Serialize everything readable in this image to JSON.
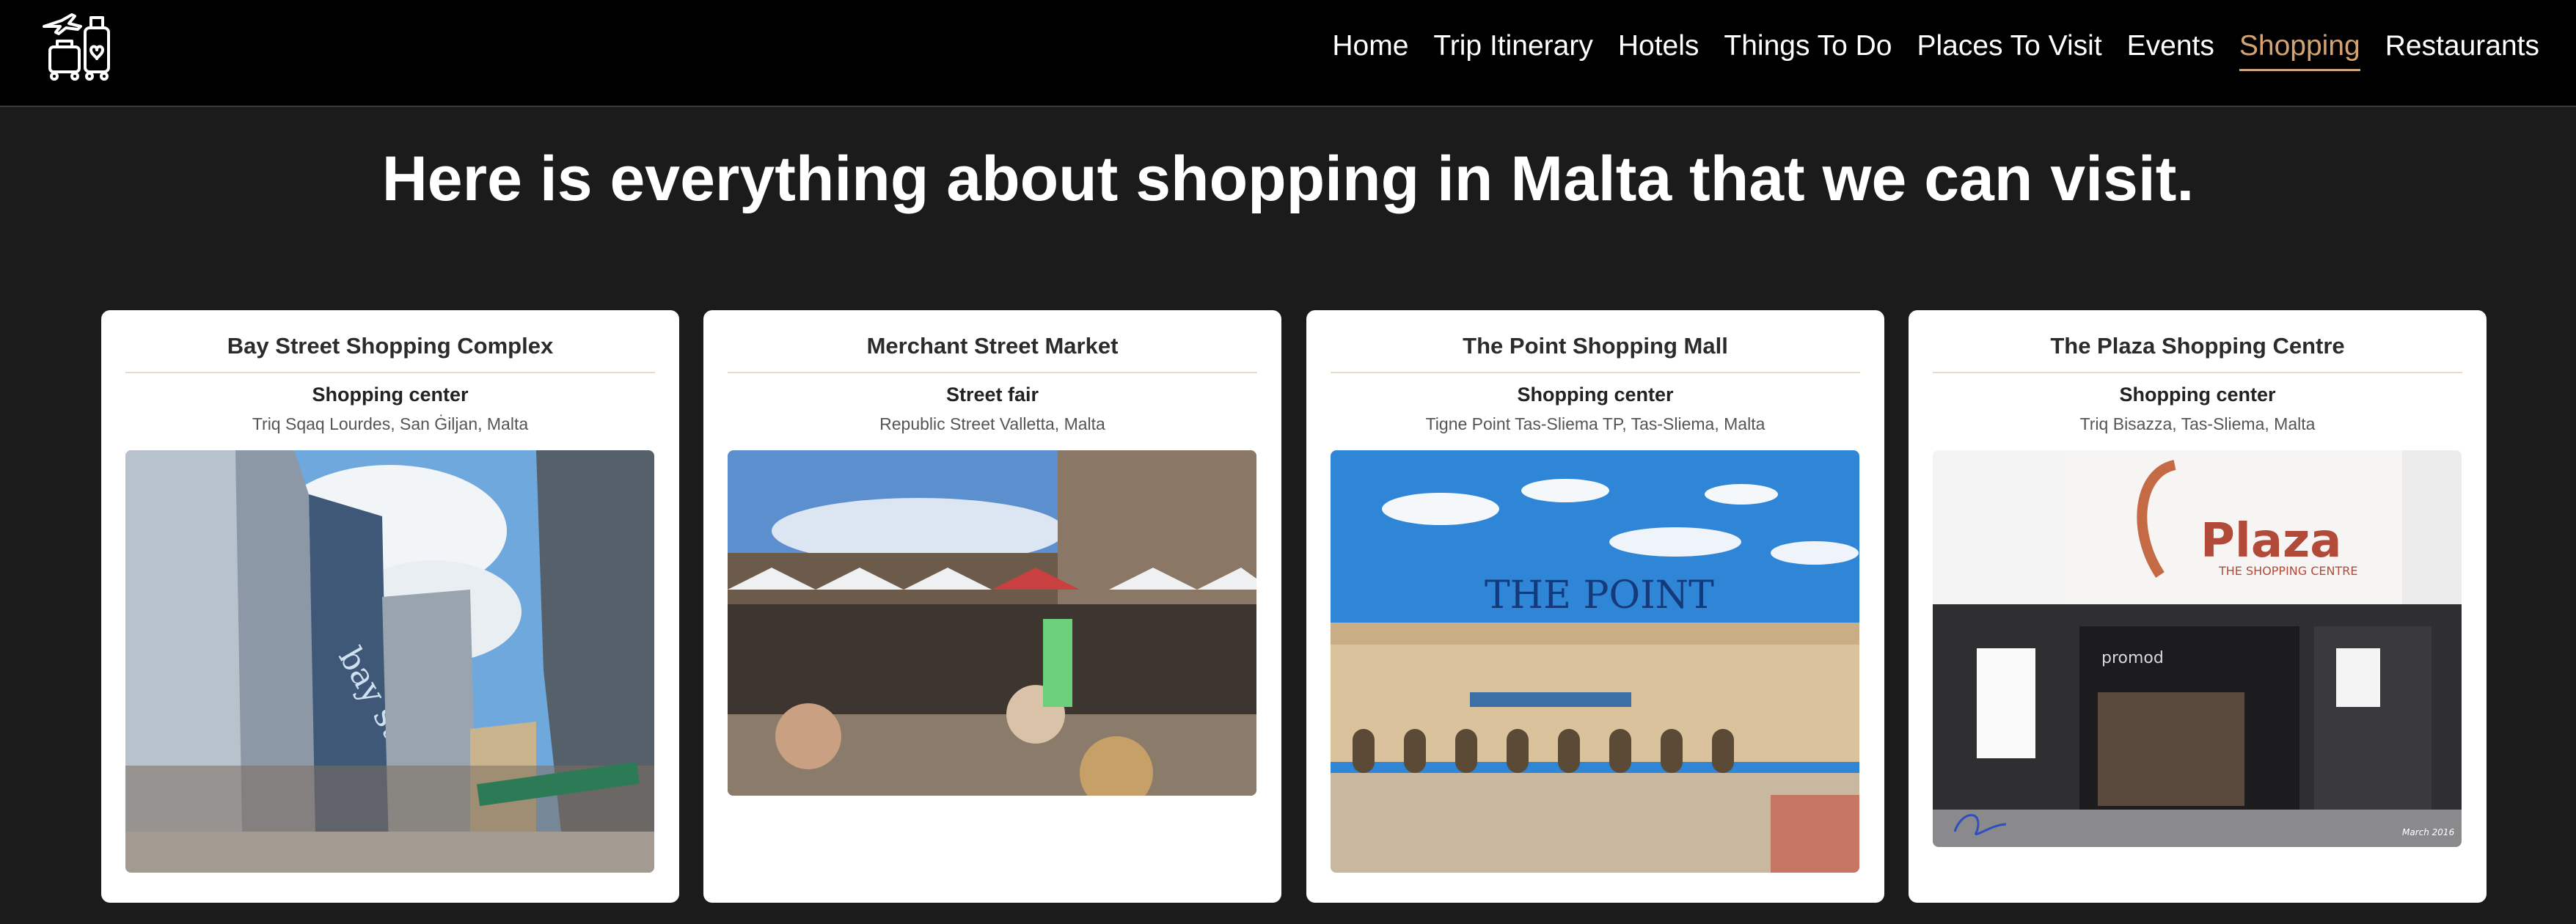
{
  "nav": {
    "logo_icon": "travel-luggage-logo-icon",
    "links": [
      {
        "label": "Home",
        "active": false
      },
      {
        "label": "Trip Itinerary",
        "active": false
      },
      {
        "label": "Hotels",
        "active": false
      },
      {
        "label": "Things To Do",
        "active": false
      },
      {
        "label": "Places To Visit",
        "active": false
      },
      {
        "label": "Events",
        "active": false
      },
      {
        "label": "Shopping",
        "active": true
      },
      {
        "label": "Restaurants",
        "active": false
      }
    ],
    "active_color": "#d4a373"
  },
  "page": {
    "title": "Here is everything about shopping in Malta that we can visit."
  },
  "cards": [
    {
      "title": "Bay Street Shopping Complex",
      "type": "Shopping center",
      "address": "Triq Sqaq Lourdes, San Ġiljan, Malta",
      "image_sign": "bay street"
    },
    {
      "title": "Merchant Street Market",
      "type": "Street fair",
      "address": "Republic Street Valletta, Malta"
    },
    {
      "title": "The Point Shopping Mall",
      "type": "Shopping center",
      "address": "Tigne Point Tas-Sliema TP, Tas-Sliema, Malta",
      "image_sign": "THE POINT"
    },
    {
      "title": "The Plaza Shopping Centre",
      "type": "Shopping center",
      "address": "Triq Bisazza, Tas-Sliema, Malta",
      "image_sign": "Plaza",
      "image_sign_sub": "THE SHOPPING CENTRE",
      "image_store": "promod",
      "image_caption": "March 2016"
    }
  ]
}
